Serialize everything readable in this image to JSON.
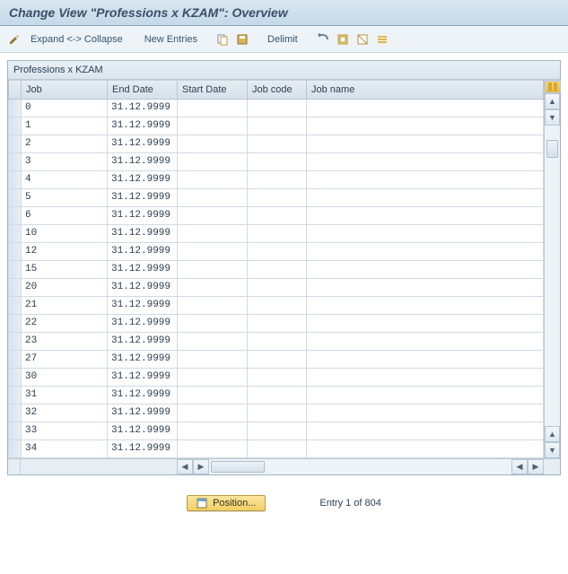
{
  "header": {
    "title": "Change View \"Professions x KZAM\": Overview"
  },
  "toolbar": {
    "expand_collapse": "Expand <-> Collapse",
    "new_entries": "New Entries",
    "delimit": "Delimit"
  },
  "panel": {
    "title": "Professions x KZAM"
  },
  "columns": {
    "job": "Job",
    "end_date": "End Date",
    "start_date": "Start Date",
    "job_code": "Job code",
    "job_name": "Job name"
  },
  "rows": [
    {
      "job": "0",
      "end_date": "31.12.9999",
      "start_date": "",
      "job_code": "",
      "job_name": ""
    },
    {
      "job": "1",
      "end_date": "31.12.9999",
      "start_date": "",
      "job_code": "",
      "job_name": ""
    },
    {
      "job": "2",
      "end_date": "31.12.9999",
      "start_date": "",
      "job_code": "",
      "job_name": ""
    },
    {
      "job": "3",
      "end_date": "31.12.9999",
      "start_date": "",
      "job_code": "",
      "job_name": ""
    },
    {
      "job": "4",
      "end_date": "31.12.9999",
      "start_date": "",
      "job_code": "",
      "job_name": ""
    },
    {
      "job": "5",
      "end_date": "31.12.9999",
      "start_date": "",
      "job_code": "",
      "job_name": ""
    },
    {
      "job": "6",
      "end_date": "31.12.9999",
      "start_date": "",
      "job_code": "",
      "job_name": ""
    },
    {
      "job": "10",
      "end_date": "31.12.9999",
      "start_date": "",
      "job_code": "",
      "job_name": ""
    },
    {
      "job": "12",
      "end_date": "31.12.9999",
      "start_date": "",
      "job_code": "",
      "job_name": ""
    },
    {
      "job": "15",
      "end_date": "31.12.9999",
      "start_date": "",
      "job_code": "",
      "job_name": ""
    },
    {
      "job": "20",
      "end_date": "31.12.9999",
      "start_date": "",
      "job_code": "",
      "job_name": ""
    },
    {
      "job": "21",
      "end_date": "31.12.9999",
      "start_date": "",
      "job_code": "",
      "job_name": ""
    },
    {
      "job": "22",
      "end_date": "31.12.9999",
      "start_date": "",
      "job_code": "",
      "job_name": ""
    },
    {
      "job": "23",
      "end_date": "31.12.9999",
      "start_date": "",
      "job_code": "",
      "job_name": ""
    },
    {
      "job": "27",
      "end_date": "31.12.9999",
      "start_date": "",
      "job_code": "",
      "job_name": ""
    },
    {
      "job": "30",
      "end_date": "31.12.9999",
      "start_date": "",
      "job_code": "",
      "job_name": ""
    },
    {
      "job": "31",
      "end_date": "31.12.9999",
      "start_date": "",
      "job_code": "",
      "job_name": ""
    },
    {
      "job": "32",
      "end_date": "31.12.9999",
      "start_date": "",
      "job_code": "",
      "job_name": ""
    },
    {
      "job": "33",
      "end_date": "31.12.9999",
      "start_date": "",
      "job_code": "",
      "job_name": ""
    },
    {
      "job": "34",
      "end_date": "31.12.9999",
      "start_date": "",
      "job_code": "",
      "job_name": ""
    }
  ],
  "footer": {
    "position_label": "Position...",
    "entry_text": "Entry 1 of 804"
  }
}
